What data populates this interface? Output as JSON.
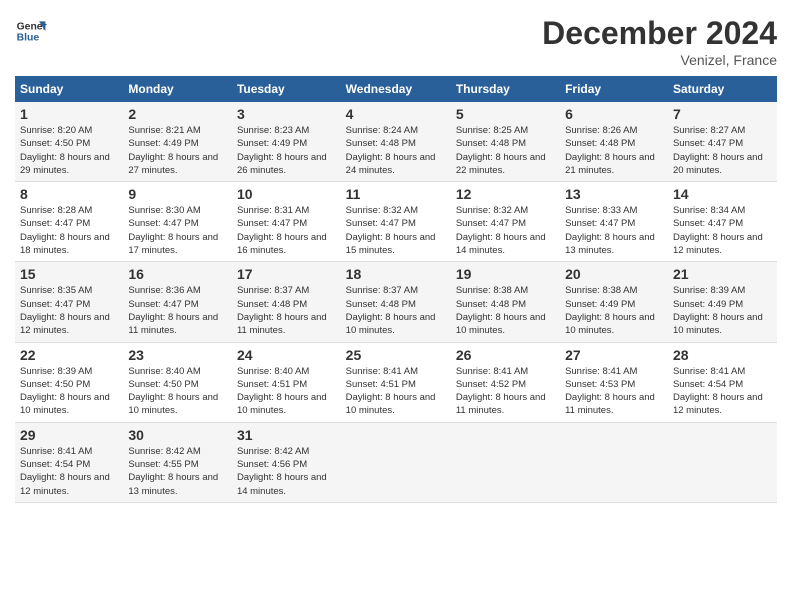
{
  "header": {
    "logo_line1": "General",
    "logo_line2": "Blue",
    "month": "December 2024",
    "location": "Venizel, France"
  },
  "days_of_week": [
    "Sunday",
    "Monday",
    "Tuesday",
    "Wednesday",
    "Thursday",
    "Friday",
    "Saturday"
  ],
  "weeks": [
    [
      {
        "num": "1",
        "sunrise": "8:20 AM",
        "sunset": "4:50 PM",
        "daylight": "8 hours and 29 minutes."
      },
      {
        "num": "2",
        "sunrise": "8:21 AM",
        "sunset": "4:49 PM",
        "daylight": "8 hours and 27 minutes."
      },
      {
        "num": "3",
        "sunrise": "8:23 AM",
        "sunset": "4:49 PM",
        "daylight": "8 hours and 26 minutes."
      },
      {
        "num": "4",
        "sunrise": "8:24 AM",
        "sunset": "4:48 PM",
        "daylight": "8 hours and 24 minutes."
      },
      {
        "num": "5",
        "sunrise": "8:25 AM",
        "sunset": "4:48 PM",
        "daylight": "8 hours and 22 minutes."
      },
      {
        "num": "6",
        "sunrise": "8:26 AM",
        "sunset": "4:48 PM",
        "daylight": "8 hours and 21 minutes."
      },
      {
        "num": "7",
        "sunrise": "8:27 AM",
        "sunset": "4:47 PM",
        "daylight": "8 hours and 20 minutes."
      }
    ],
    [
      {
        "num": "8",
        "sunrise": "8:28 AM",
        "sunset": "4:47 PM",
        "daylight": "8 hours and 18 minutes."
      },
      {
        "num": "9",
        "sunrise": "8:30 AM",
        "sunset": "4:47 PM",
        "daylight": "8 hours and 17 minutes."
      },
      {
        "num": "10",
        "sunrise": "8:31 AM",
        "sunset": "4:47 PM",
        "daylight": "8 hours and 16 minutes."
      },
      {
        "num": "11",
        "sunrise": "8:32 AM",
        "sunset": "4:47 PM",
        "daylight": "8 hours and 15 minutes."
      },
      {
        "num": "12",
        "sunrise": "8:32 AM",
        "sunset": "4:47 PM",
        "daylight": "8 hours and 14 minutes."
      },
      {
        "num": "13",
        "sunrise": "8:33 AM",
        "sunset": "4:47 PM",
        "daylight": "8 hours and 13 minutes."
      },
      {
        "num": "14",
        "sunrise": "8:34 AM",
        "sunset": "4:47 PM",
        "daylight": "8 hours and 12 minutes."
      }
    ],
    [
      {
        "num": "15",
        "sunrise": "8:35 AM",
        "sunset": "4:47 PM",
        "daylight": "8 hours and 12 minutes."
      },
      {
        "num": "16",
        "sunrise": "8:36 AM",
        "sunset": "4:47 PM",
        "daylight": "8 hours and 11 minutes."
      },
      {
        "num": "17",
        "sunrise": "8:37 AM",
        "sunset": "4:48 PM",
        "daylight": "8 hours and 11 minutes."
      },
      {
        "num": "18",
        "sunrise": "8:37 AM",
        "sunset": "4:48 PM",
        "daylight": "8 hours and 10 minutes."
      },
      {
        "num": "19",
        "sunrise": "8:38 AM",
        "sunset": "4:48 PM",
        "daylight": "8 hours and 10 minutes."
      },
      {
        "num": "20",
        "sunrise": "8:38 AM",
        "sunset": "4:49 PM",
        "daylight": "8 hours and 10 minutes."
      },
      {
        "num": "21",
        "sunrise": "8:39 AM",
        "sunset": "4:49 PM",
        "daylight": "8 hours and 10 minutes."
      }
    ],
    [
      {
        "num": "22",
        "sunrise": "8:39 AM",
        "sunset": "4:50 PM",
        "daylight": "8 hours and 10 minutes."
      },
      {
        "num": "23",
        "sunrise": "8:40 AM",
        "sunset": "4:50 PM",
        "daylight": "8 hours and 10 minutes."
      },
      {
        "num": "24",
        "sunrise": "8:40 AM",
        "sunset": "4:51 PM",
        "daylight": "8 hours and 10 minutes."
      },
      {
        "num": "25",
        "sunrise": "8:41 AM",
        "sunset": "4:51 PM",
        "daylight": "8 hours and 10 minutes."
      },
      {
        "num": "26",
        "sunrise": "8:41 AM",
        "sunset": "4:52 PM",
        "daylight": "8 hours and 11 minutes."
      },
      {
        "num": "27",
        "sunrise": "8:41 AM",
        "sunset": "4:53 PM",
        "daylight": "8 hours and 11 minutes."
      },
      {
        "num": "28",
        "sunrise": "8:41 AM",
        "sunset": "4:54 PM",
        "daylight": "8 hours and 12 minutes."
      }
    ],
    [
      {
        "num": "29",
        "sunrise": "8:41 AM",
        "sunset": "4:54 PM",
        "daylight": "8 hours and 12 minutes."
      },
      {
        "num": "30",
        "sunrise": "8:42 AM",
        "sunset": "4:55 PM",
        "daylight": "8 hours and 13 minutes."
      },
      {
        "num": "31",
        "sunrise": "8:42 AM",
        "sunset": "4:56 PM",
        "daylight": "8 hours and 14 minutes."
      },
      null,
      null,
      null,
      null
    ]
  ]
}
